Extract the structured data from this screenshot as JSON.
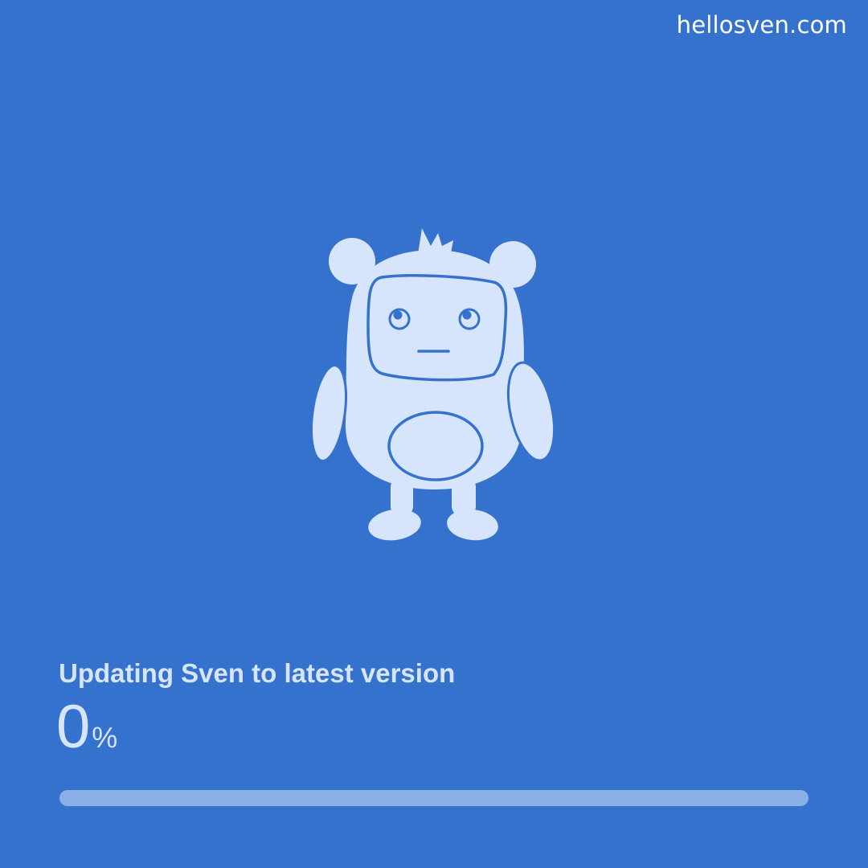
{
  "brand": {
    "label": "hellosven.com"
  },
  "mascot": {
    "icon": "robot-bear-mascot-icon",
    "fill_color": "#D6E5FB",
    "line_color": "#3572CE"
  },
  "update": {
    "title": "Updating Sven to latest version",
    "progress_value": "0",
    "progress_unit": "%",
    "progress_fraction": 0
  },
  "colors": {
    "background": "#3572CE",
    "text": "#D6E5FB",
    "track": "#8AAFE6",
    "brand_text": "#FFFFFF"
  }
}
